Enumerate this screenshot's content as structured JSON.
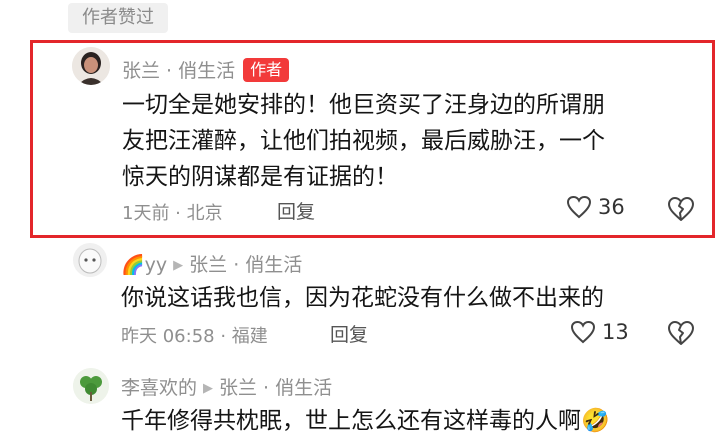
{
  "liked_by_author_label": "作者赞过",
  "comments": [
    {
      "user": "张兰 · 俏生活",
      "author_badge": "作者",
      "text_lines": [
        "一切全是她安排的！他巨资买了汪身边的所谓朋",
        "友把汪灌醉，让他们拍视频，最后威胁汪，一个",
        "惊天的阴谋都是有证据的！"
      ],
      "time_location": "1天前 · 北京",
      "reply_label": "回复",
      "like_count": "36"
    },
    {
      "user": "🌈yy",
      "reply_to": "张兰 · 俏生活",
      "text_lines": [
        "你说这话我也信，因为花蛇没有什么做不出来的"
      ],
      "time_location": "昨天 06:58 · 福建",
      "reply_label": "回复",
      "like_count": "13"
    },
    {
      "user": "李喜欢的",
      "reply_to": "张兰 · 俏生活",
      "text_lines": [
        "千年修得共枕眠，世上怎么还有这样毒的人啊🤣"
      ]
    }
  ]
}
